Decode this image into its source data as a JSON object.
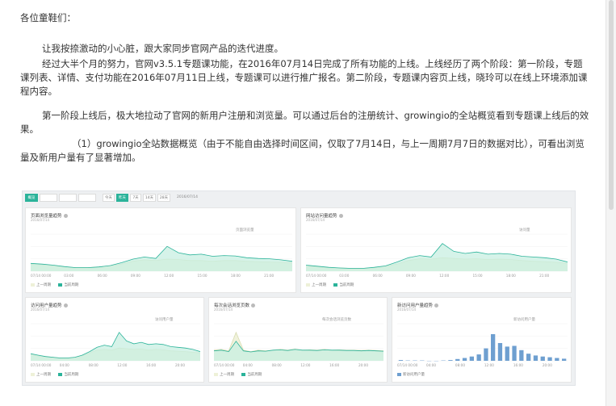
{
  "document": {
    "greeting": "各位童鞋们：",
    "para1": "让我按捺激动的小心脏，跟大家同步官网产品的迭代进度。",
    "para2_line1": "经过大半个月的努力，官网v3.5.1专题课功能，在2016年07月14日完成了所有功能的上线。上线经历了两个阶段：第一阶段，专题",
    "para2_line2": "课列表、详情、支付功能在2016年07月11日上线，专题课可以进行推广报名。第二阶段，专题课内容页上线，晓玲可以在线上环境添加课",
    "para2_line3": "程内容。",
    "para3_line1": "第一阶段上线后，极大地拉动了官网的新用户注册和浏览量。可以通过后台的注册统计、growingio的全站概览看到专题课上线后的效",
    "para3_line2": "果。",
    "para4_line1": "（1）growingio全站数据概览（由于不能自由选择时间区间，仅取了7月14日，与上一周期7月7日的数据对比），可看出浏览",
    "para4_line2": "量及新用户量有了显著增加。"
  },
  "dashboard": {
    "toolbar": {
      "buttons": [
        {
          "label": "概览",
          "active": true
        },
        {
          "label": "",
          "active": false
        },
        {
          "label": "",
          "active": false
        },
        {
          "label": "",
          "active": false
        }
      ],
      "ranges": [
        {
          "label": "今天",
          "active": false
        },
        {
          "label": "昨天",
          "active": true
        },
        {
          "label": "7天",
          "active": false
        },
        {
          "label": "14天",
          "active": false
        },
        {
          "label": "28天",
          "active": false
        }
      ],
      "date": "2016/07/14"
    },
    "legend_prev": "上一周期",
    "legend_curr": "当前周期",
    "legend_new_users": "新访问用户量",
    "colors": {
      "accent": "#2bb39a",
      "prev_fill": "#eef1d8",
      "curr_fill": "#c8efe2",
      "bar": "#6e9fd0"
    }
  },
  "chart_data": [
    {
      "type": "area",
      "title": "页面浏览量趋势",
      "subtitle": "2016/07/14",
      "series_label": "页面浏览量",
      "x_ticks": [
        "07/14 00:00",
        "03:00",
        "06:00",
        "09:00",
        "12:00",
        "15:00",
        "18:00",
        "21:00"
      ],
      "series": [
        {
          "name": "上一周期",
          "values": [
            0.2,
            0.18,
            0.15,
            0.12,
            0.1,
            0.1,
            0.12,
            0.15,
            0.2,
            0.28,
            0.32,
            0.3,
            0.34,
            0.33,
            0.3,
            0.3,
            0.28,
            0.3,
            0.3,
            0.28,
            0.27,
            0.26,
            0.25,
            0.24
          ]
        },
        {
          "name": "当前周期",
          "values": [
            0.22,
            0.2,
            0.17,
            0.13,
            0.1,
            0.1,
            0.12,
            0.16,
            0.24,
            0.34,
            0.4,
            0.36,
            0.7,
            0.52,
            0.46,
            0.48,
            0.42,
            0.44,
            0.43,
            0.38,
            0.36,
            0.35,
            0.32,
            0.28
          ]
        }
      ]
    },
    {
      "type": "area",
      "title": "网站访问量趋势",
      "subtitle": "2016/07/14",
      "series_label": "访问量",
      "x_ticks": [
        "07/14 00:00",
        "03:00",
        "06:00",
        "09:00",
        "12:00",
        "15:00",
        "18:00",
        "21:00"
      ],
      "series": [
        {
          "name": "上一周期",
          "values": [
            0.15,
            0.12,
            0.1,
            0.09,
            0.08,
            0.08,
            0.1,
            0.14,
            0.2,
            0.3,
            0.35,
            0.34,
            0.38,
            0.36,
            0.34,
            0.35,
            0.33,
            0.34,
            0.33,
            0.3,
            0.28,
            0.27,
            0.25,
            0.22
          ]
        },
        {
          "name": "当前周期",
          "values": [
            0.17,
            0.14,
            0.11,
            0.09,
            0.08,
            0.08,
            0.11,
            0.15,
            0.26,
            0.38,
            0.44,
            0.4,
            0.78,
            0.56,
            0.5,
            0.54,
            0.48,
            0.5,
            0.48,
            0.42,
            0.4,
            0.38,
            0.34,
            0.26
          ]
        }
      ]
    },
    {
      "type": "area",
      "title": "访问用户量趋势",
      "subtitle": "2016/07/14",
      "series_label": "访问用户量",
      "x_ticks": [
        "07/14 00:00",
        "04:00",
        "08:00",
        "12:00",
        "16:00",
        "20:00"
      ],
      "series": [
        {
          "name": "上一周期",
          "values": [
            0.18,
            0.14,
            0.12,
            0.1,
            0.08,
            0.08,
            0.1,
            0.14,
            0.22,
            0.3,
            0.32,
            0.3,
            0.36,
            0.34,
            0.32,
            0.33,
            0.3,
            0.32,
            0.31,
            0.28,
            0.27,
            0.26,
            0.24,
            0.22
          ]
        },
        {
          "name": "当前周期",
          "values": [
            0.2,
            0.16,
            0.12,
            0.1,
            0.08,
            0.08,
            0.1,
            0.16,
            0.26,
            0.38,
            0.44,
            0.4,
            0.8,
            0.56,
            0.48,
            0.52,
            0.46,
            0.48,
            0.46,
            0.4,
            0.38,
            0.36,
            0.32,
            0.26
          ]
        }
      ]
    },
    {
      "type": "area",
      "title": "每次会话浏览页数",
      "subtitle": "2016/07/14",
      "series_label": "每次会话浏览页数",
      "x_ticks": [
        "07/14 00:00",
        "04:00",
        "08:00",
        "12:00",
        "16:00",
        "20:00"
      ],
      "series": [
        {
          "name": "上一周期",
          "values": [
            0.3,
            0.32,
            0.28,
            0.8,
            0.3,
            0.26,
            0.3,
            0.28,
            0.3,
            0.32,
            0.3,
            0.33,
            0.3,
            0.31,
            0.3,
            0.32,
            0.3,
            0.31,
            0.3,
            0.3,
            0.29,
            0.3,
            0.29,
            0.28
          ]
        },
        {
          "name": "当前周期",
          "values": [
            0.28,
            0.3,
            0.26,
            0.55,
            0.28,
            0.25,
            0.28,
            0.27,
            0.3,
            0.31,
            0.29,
            0.32,
            0.3,
            0.3,
            0.29,
            0.31,
            0.3,
            0.3,
            0.29,
            0.29,
            0.28,
            0.29,
            0.28,
            0.27
          ]
        }
      ]
    },
    {
      "type": "bar",
      "title": "新访问用户量趋势",
      "subtitle": "2016/07/14",
      "series_label": "新访问用户量",
      "x_ticks": [
        "07/14 00:00",
        "04:00",
        "08:00",
        "12:00",
        "16:00",
        "20:00"
      ],
      "series": [
        {
          "name": "新访问用户量",
          "values": [
            0.02,
            0.01,
            0.01,
            0.01,
            0.0,
            0.0,
            0.01,
            0.02,
            0.05,
            0.08,
            0.12,
            0.18,
            0.35,
            0.75,
            0.5,
            0.4,
            0.42,
            0.3,
            0.2,
            0.15,
            0.12,
            0.1,
            0.08,
            0.06
          ]
        }
      ]
    }
  ]
}
